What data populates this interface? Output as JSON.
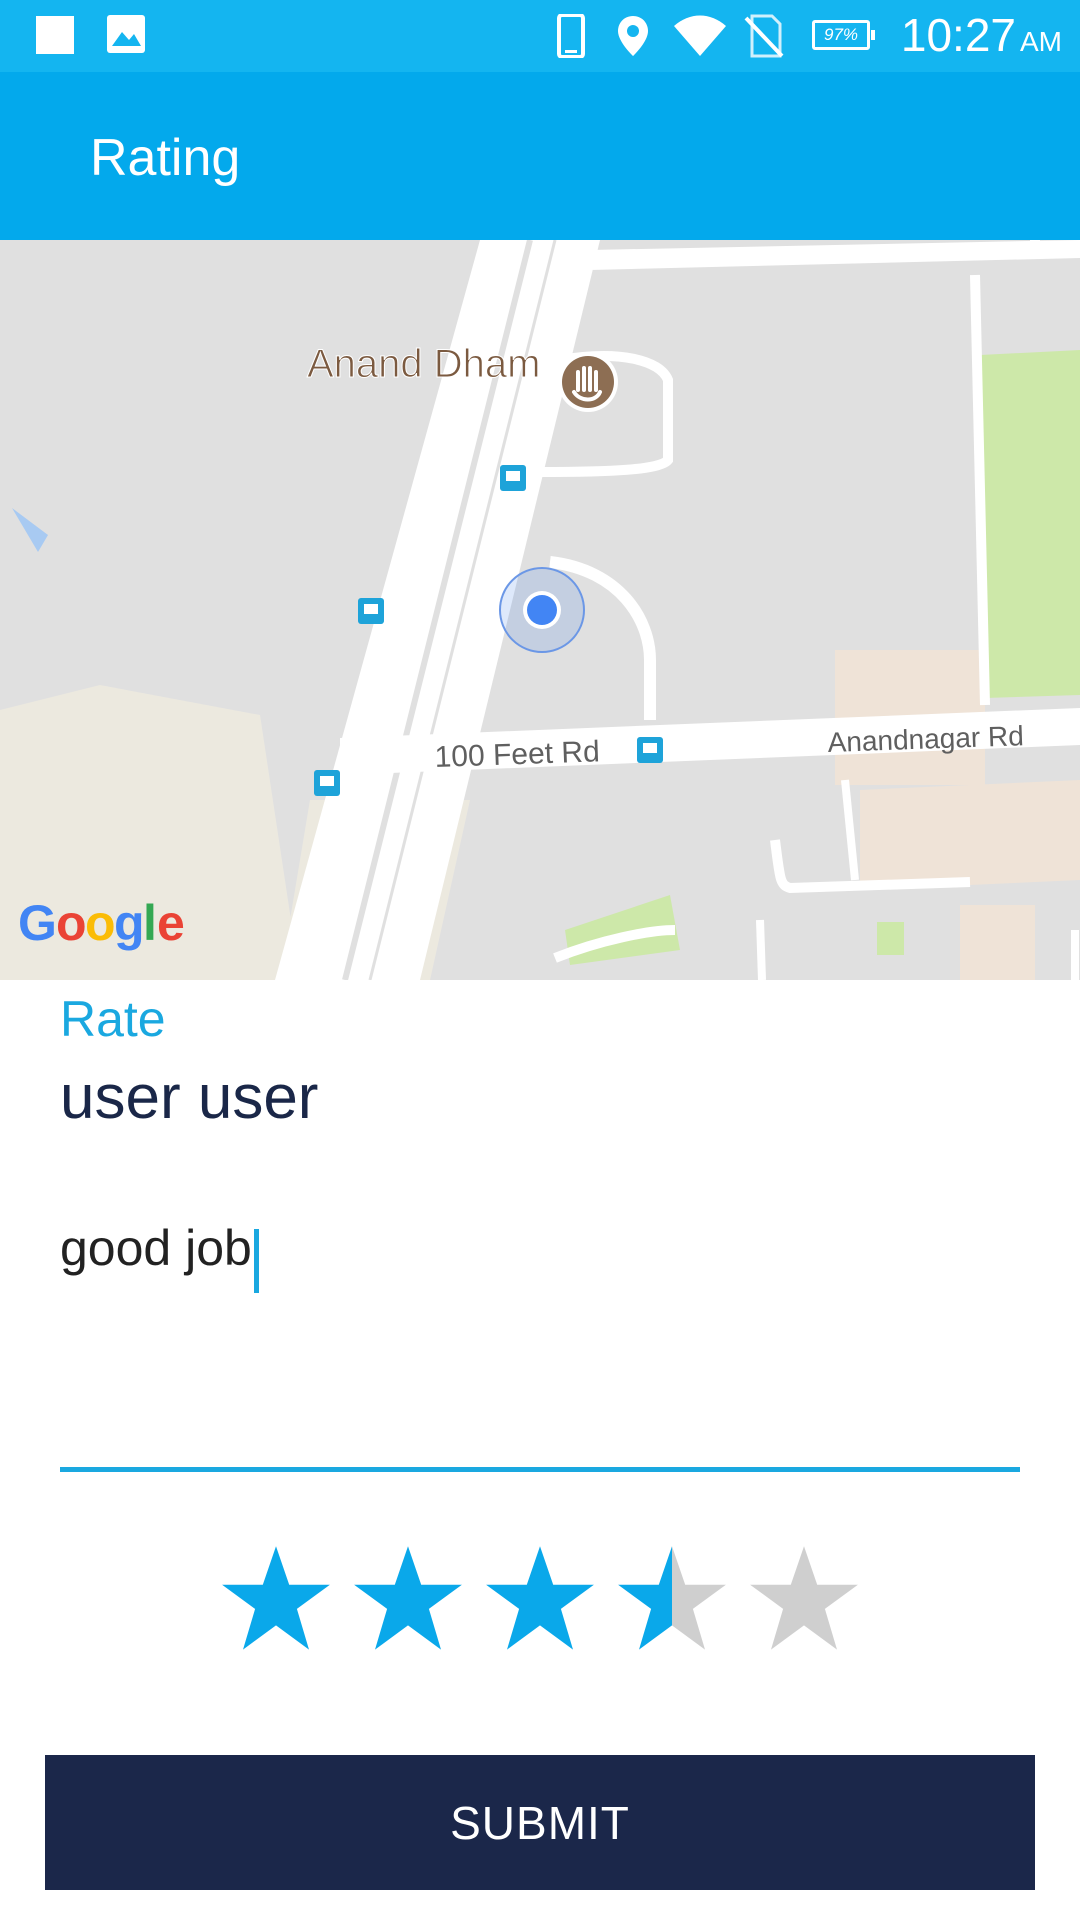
{
  "status_bar": {
    "time": "10:27",
    "ampm": "AM",
    "battery": "97%",
    "icons": [
      "stop-icon",
      "image-icon",
      "phone-icon",
      "location-icon",
      "wifi-icon",
      "no-sim-icon",
      "battery-icon"
    ]
  },
  "app_bar": {
    "title": "Rating"
  },
  "map": {
    "place_label": "Anand Dham",
    "road_label_1": "100 Feet Rd",
    "road_label_2": "Anandnagar Rd",
    "logo": "Google"
  },
  "form": {
    "rate_label": "Rate",
    "user_name": "user user",
    "comment_value": "good job",
    "rating": {
      "value": 3.5,
      "max": 5
    }
  },
  "submit_label": "SUBMIT",
  "colors": {
    "status_bar": "#14b5f0",
    "app_bar": "#03a9ec",
    "accent": "#1aa8e0",
    "star_filled": "#0aa8ea",
    "star_empty": "#cfcfcf",
    "button": "#1b274a"
  }
}
